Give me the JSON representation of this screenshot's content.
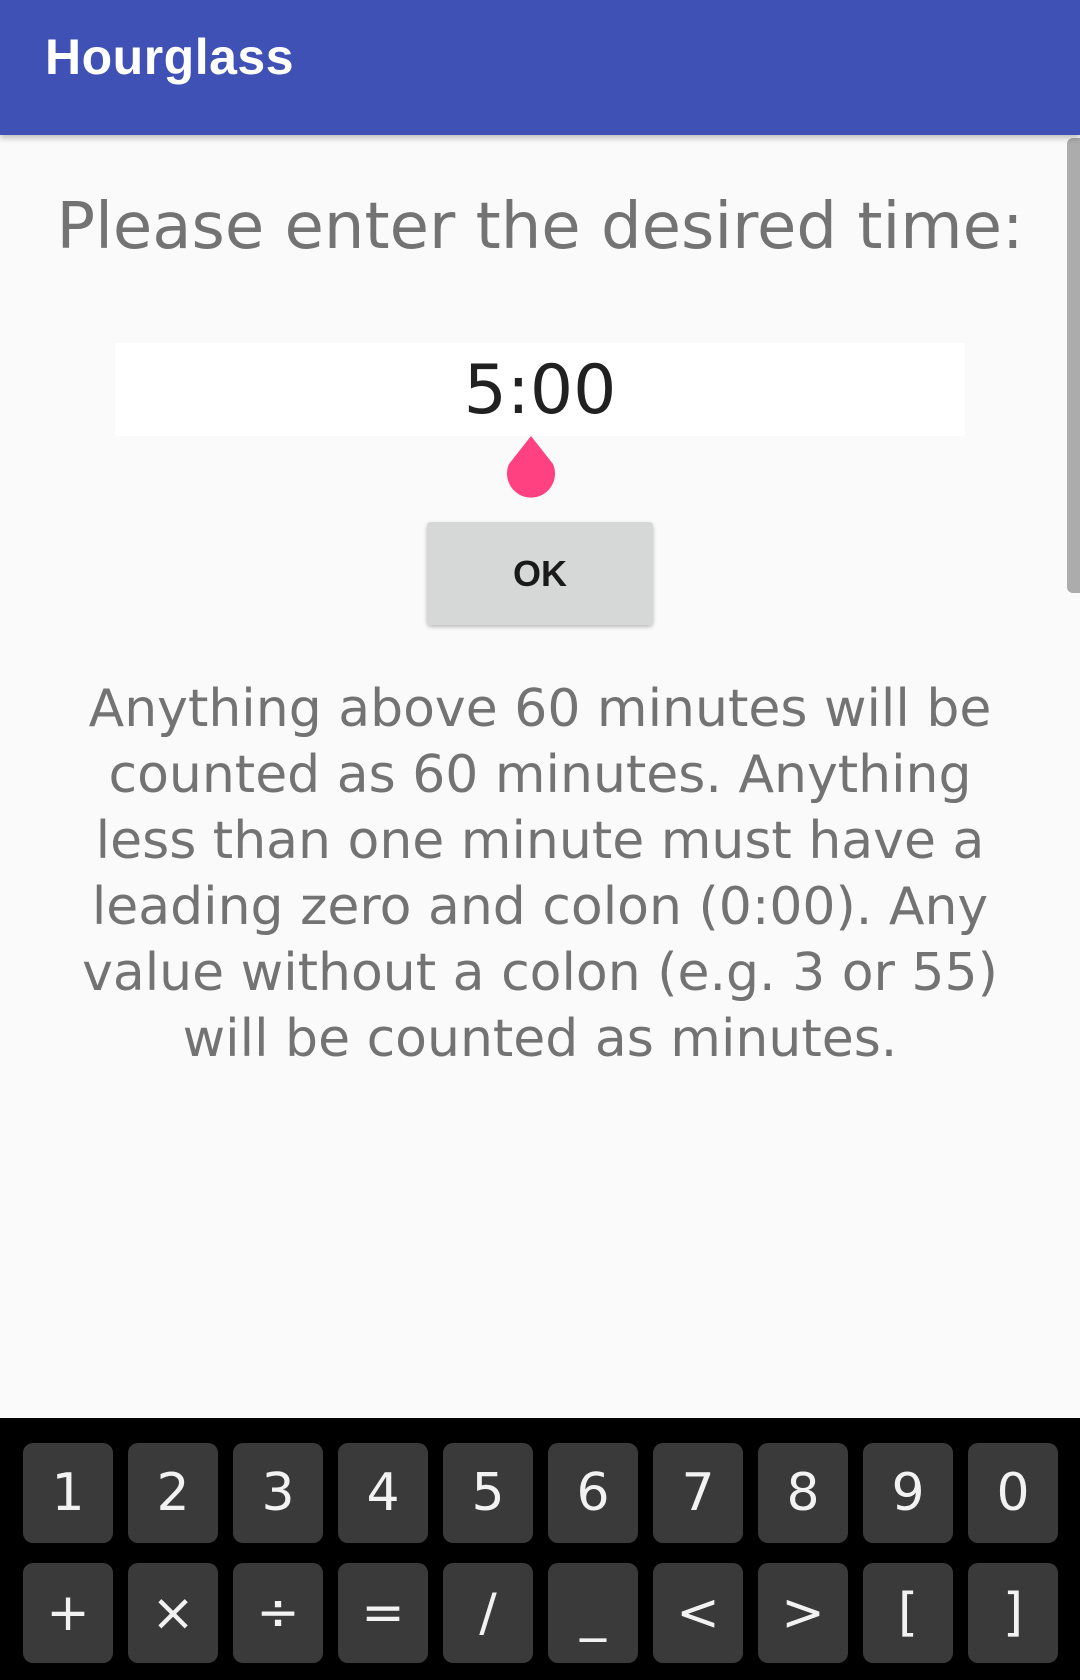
{
  "appbar": {
    "title": "Hourglass"
  },
  "main": {
    "prompt": "Please enter the desired time:",
    "time_value": "5:00",
    "ok_label": "OK",
    "info": "Anything above 60 minutes will be counted as 60 minutes. Anything less than one minute must have a leading zero and colon (0:00). Any value without a colon (e.g. 3 or 55) will be counted as minutes."
  },
  "keyboard": {
    "row1": [
      "1",
      "2",
      "3",
      "4",
      "5",
      "6",
      "7",
      "8",
      "9",
      "0"
    ],
    "row2": [
      "+",
      "×",
      "÷",
      "=",
      "/",
      "_",
      "<",
      ">",
      "[",
      "]"
    ]
  },
  "colors": {
    "appbar": "#3f51b5",
    "accent_handle": "#ff4081",
    "button": "#d6d7d7"
  }
}
